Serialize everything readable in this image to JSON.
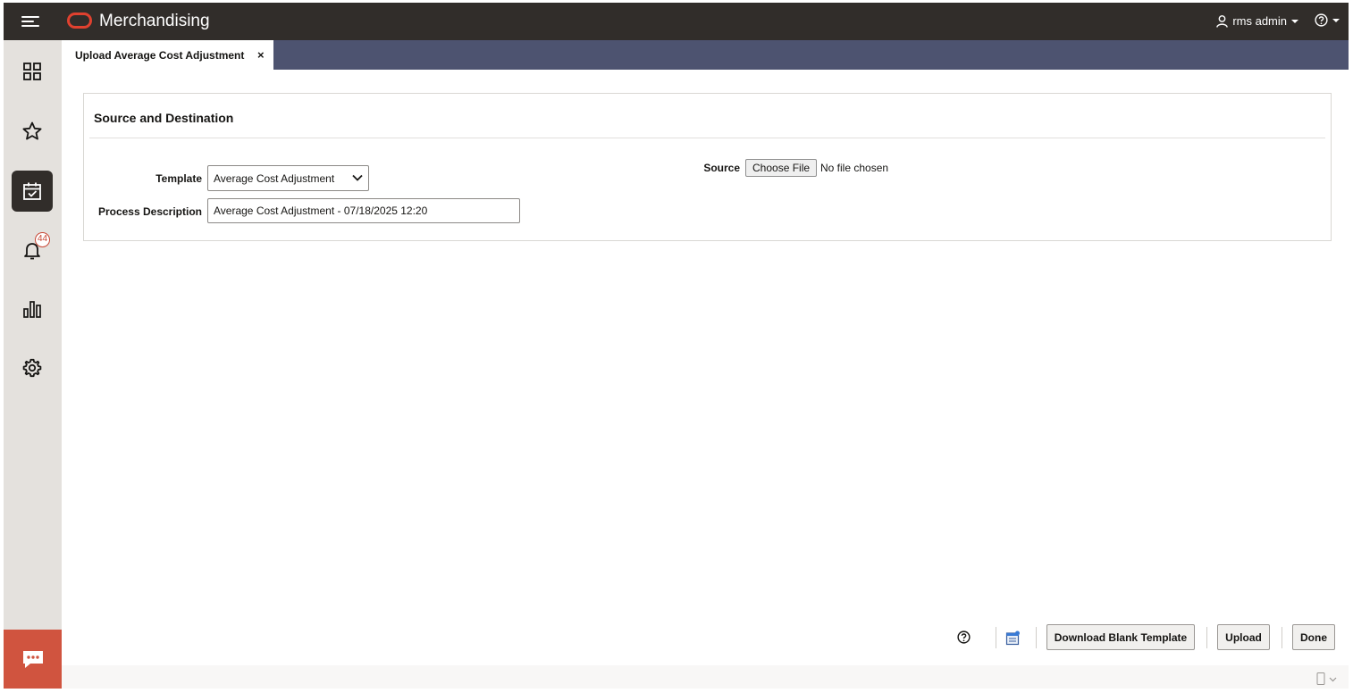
{
  "header": {
    "app_title": "Merchandising",
    "user_name": "rms admin",
    "brand_color": "#e0412f",
    "bar_color": "#312d2a"
  },
  "rail": {
    "items": [
      {
        "name": "dashboard",
        "icon": "grid-icon"
      },
      {
        "name": "favorites",
        "icon": "star-icon"
      },
      {
        "name": "tasks",
        "icon": "calendar-check-icon",
        "active": true
      },
      {
        "name": "notifications",
        "icon": "bell-icon",
        "badge": "44"
      },
      {
        "name": "reports",
        "icon": "bar-chart-icon"
      },
      {
        "name": "settings",
        "icon": "gear-icon"
      }
    ],
    "chat_icon": "chat-icon"
  },
  "tabs": [
    {
      "label": "Upload Average Cost Adjustment",
      "close": "×"
    }
  ],
  "panel": {
    "title": "Source and Destination",
    "template_label": "Template",
    "template_value": "Average Cost Adjustment",
    "process_label": "Process Description",
    "process_value": "Average Cost Adjustment - 07/18/2025 12:20",
    "source_label": "Source",
    "file_button": "Choose File",
    "file_status": "No file chosen"
  },
  "toolbar": {
    "download_label": "Download Blank Template",
    "upload_label": "Upload",
    "done_label": "Done"
  }
}
